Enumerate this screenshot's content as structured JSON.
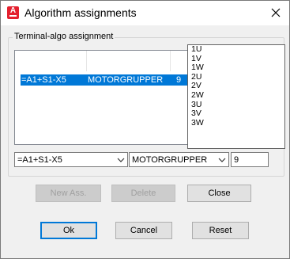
{
  "window": {
    "title": "Algorithm assignments",
    "app_icon": "autocad-electrical-icon",
    "close_icon": "close-icon"
  },
  "group": {
    "label": "Terminal-algo assignment"
  },
  "list": {
    "rows": [
      {
        "terminal": "=A1+S1-X5",
        "group": "MOTORGRUPPER",
        "algo": "9",
        "selected": true
      }
    ]
  },
  "dropdown": {
    "options": [
      "1U",
      "1V",
      "1W",
      "2U",
      "2V",
      "2W",
      "3U",
      "3V",
      "3W"
    ]
  },
  "inputs": {
    "terminal_combo": "=A1+S1-X5",
    "group_combo": "MOTORGRUPPER",
    "algo_field": "9"
  },
  "buttons": {
    "new_ass": "New Ass.",
    "delete": "Delete",
    "close": "Close",
    "ok": "Ok",
    "cancel": "Cancel",
    "reset": "Reset"
  },
  "colors": {
    "selection": "#0078d7",
    "app_icon_red": "#e4202e",
    "focus_border": "#0078d7"
  }
}
